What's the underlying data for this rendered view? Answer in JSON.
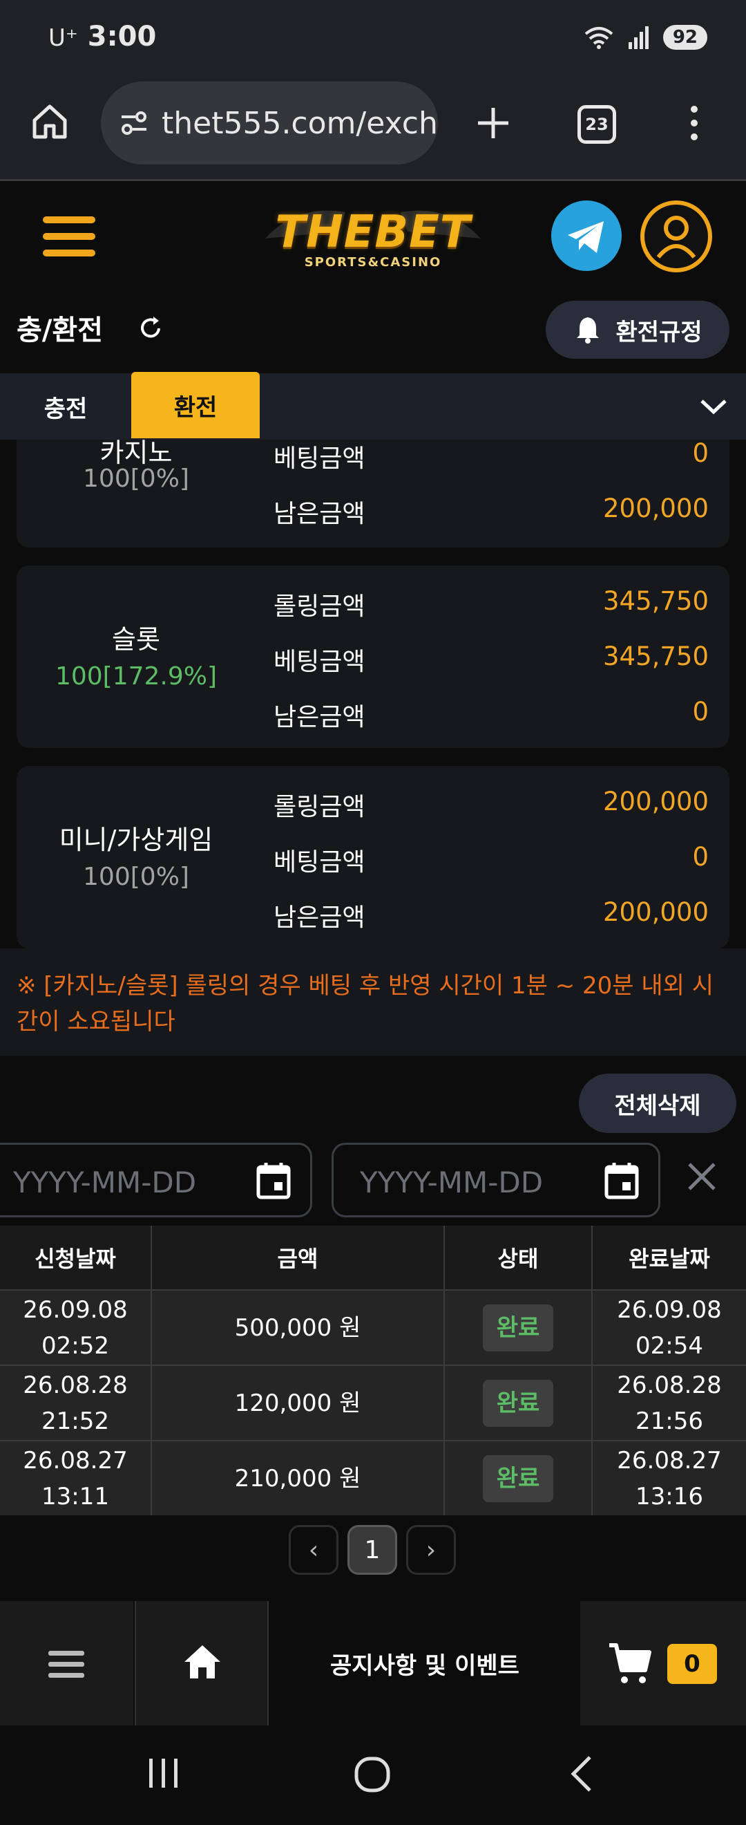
{
  "status_bar": {
    "carrier": "U⁺",
    "time": "3:00",
    "battery": "92"
  },
  "browser": {
    "url": "thet555.com/exch",
    "tab_count": "23"
  },
  "site": {
    "logo_main": "THEBET",
    "logo_sub": "SPORTS&CASINO"
  },
  "page": {
    "title": "충/환전",
    "rule_button": "환전규정"
  },
  "tabs": [
    {
      "label": "충전",
      "active": false
    },
    {
      "label": "환전",
      "active": true
    }
  ],
  "rolling": {
    "labels": {
      "rolling": "롤링금액",
      "betting": "베팅금액",
      "remaining": "남은금액"
    },
    "cards": [
      {
        "name": "카지노",
        "percent": "100[0%]",
        "rolling": "",
        "betting": "0",
        "remaining": "200,000"
      },
      {
        "name": "슬롯",
        "percent": "100[172.9%]",
        "rolling": "345,750",
        "betting": "345,750",
        "remaining": "0"
      },
      {
        "name": "미니/가상게임",
        "percent": "100[0%]",
        "rolling": "200,000",
        "betting": "0",
        "remaining": "200,000"
      }
    ]
  },
  "notice": "※ [카지노/슬롯] 롤링의 경우 베팅 후 반영 시간이 1분 ~ 20분 내외 시간이 소요됩니다",
  "filter": {
    "delete_all": "전체삭제",
    "start_placeholder": "YYYY-MM-DD",
    "end_placeholder": "YYYY-MM-DD"
  },
  "table": {
    "headers": [
      "신청날짜",
      "금액",
      "상태",
      "완료날짜"
    ],
    "rows": [
      {
        "req_date": "26.09.08",
        "req_time": "02:52",
        "amount": "500,000 원",
        "status": "완료",
        "done_date": "26.09.08",
        "done_time": "02:54"
      },
      {
        "req_date": "26.08.28",
        "req_time": "21:52",
        "amount": "120,000 원",
        "status": "완료",
        "done_date": "26.08.28",
        "done_time": "21:56"
      },
      {
        "req_date": "26.08.27",
        "req_time": "13:11",
        "amount": "210,000 원",
        "status": "완료",
        "done_date": "26.08.27",
        "done_time": "13:16"
      }
    ]
  },
  "pagination": {
    "prev": "‹",
    "current": "1",
    "next": "›"
  },
  "bottom_nav": {
    "notice_label": "공지사항 및 이벤트",
    "cart_count": "0"
  },
  "colors": {
    "accent": "#f5b51b",
    "value": "#f3a626",
    "green": "#5cbd66",
    "notice": "#e86e1e",
    "telegram": "#27a2dd"
  },
  "icons": [
    "home-icon",
    "site-settings-icon",
    "plus-icon",
    "tabs-icon",
    "more-icon",
    "hamburger-icon",
    "telegram-icon",
    "user-icon",
    "refresh-icon",
    "bell-icon",
    "chevron-down-icon",
    "calendar-icon",
    "close-icon",
    "cart-icon"
  ]
}
